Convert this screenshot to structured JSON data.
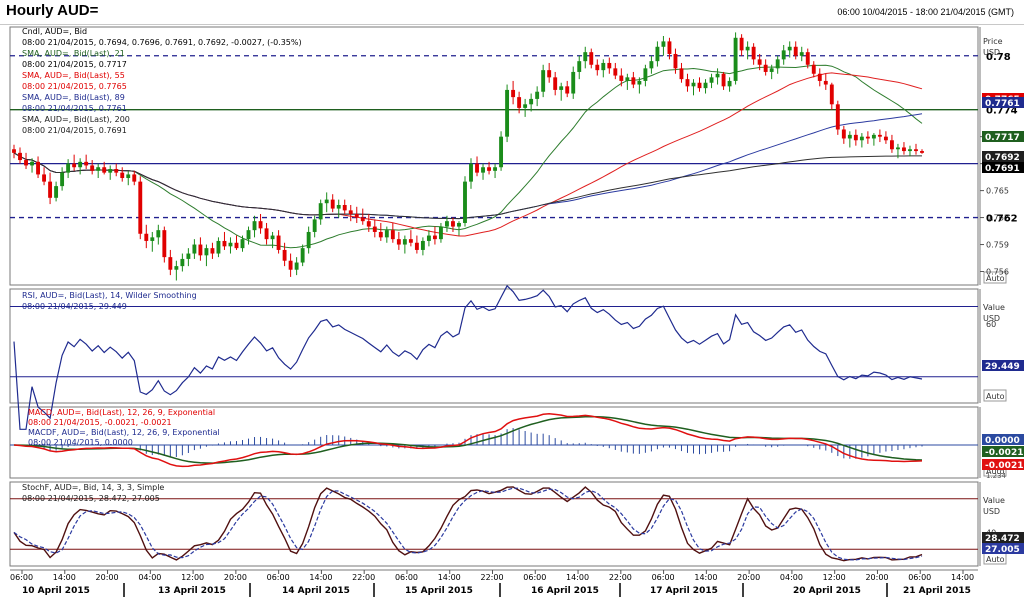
{
  "window": {
    "title": "Hourly AUD=",
    "range": "06:00 10/04/2015 - 18:00 21/04/2015 (GMT)",
    "auto_label": "Auto"
  },
  "colors": {
    "candle_up": "#1a8c1a",
    "candle_down": "#e00000",
    "sma21": "#2e7d2e",
    "sma55": "#e02020",
    "sma89": "#2b3aa0",
    "sma200": "#303030",
    "rsi": "#1f2b8f",
    "macd": "#e01010",
    "macd_signal": "#1f5f1f",
    "macd_hist": "#2b4aa0",
    "stoch_k": "#501010",
    "stoch_d": "#2b3aa0",
    "support_line": "#20208f",
    "resistance_line": "#1f5f1f",
    "dashed_line": "#20208f"
  },
  "price_panel": {
    "legend": [
      "Cndl, AUD=, Bid",
      "08:00 21/04/2015, 0.7694, 0.7696, 0.7691, 0.7692, -0.0027, (-0.35%)",
      "SMA, AUD=, Bid(Last), 21",
      "08:00 21/04/2015, 0.7717",
      "SMA, AUD=, Bid(Last), 55",
      "08:00 21/04/2015, 0.7765",
      "SMA, AUD=, Bid(Last), 89",
      "08:00 21/04/2015, 0.7761",
      "SMA, AUD=, Bid(Last), 200",
      "08:00 21/04/2015, 0.7691"
    ],
    "axis_title": [
      "Price",
      "USD"
    ],
    "ticks": [
      "0.771",
      "0.768",
      "0.765",
      "0.762",
      "0.759",
      "0.756"
    ],
    "hlines": [
      {
        "label": "0.78",
        "value": 0.78,
        "style": "dashed"
      },
      {
        "label": "0.774",
        "value": 0.774,
        "style": "solid-green"
      },
      {
        "label": "",
        "value": 0.768,
        "style": "solid-blue"
      },
      {
        "label": "0.762",
        "value": 0.762,
        "style": "dashed"
      }
    ],
    "tags": [
      {
        "label": "0.7765",
        "value": 0.7765,
        "color": "#e00000"
      },
      {
        "label": "0.7761",
        "value": 0.7761,
        "color": "#1f2b8f"
      },
      {
        "label": "0.7717",
        "value": 0.7717,
        "color": "#1f5f1f"
      },
      {
        "label": "0.7692",
        "value": 0.7692,
        "color": "#202020"
      },
      {
        "label": "0.7691",
        "value": 0.7691,
        "color": "#000000"
      }
    ]
  },
  "rsi_panel": {
    "legend": [
      "RSI, AUD=, Bid(Last), 14, Wilder Smoothing",
      "08:00 21/04/2015, 29.449"
    ],
    "axis_title": [
      "Value",
      "USD"
    ],
    "ticks": [
      "60"
    ],
    "tag": "29.449"
  },
  "macd_panel": {
    "legend": [
      "MACD, AUD=, Bid(Last), 12, 26, 9, Exponential",
      "08:00 21/04/2015, -0.0021, -0.0021",
      "MACDF, AUD=, Bid(Last), 12, 26, 9, Exponential",
      "08:00 21/04/2015, 0.0000"
    ],
    "tags": [
      "0.0000",
      "-0.0021",
      "-0.0021"
    ],
    "scale_note": "1.234"
  },
  "stoch_panel": {
    "legend": [
      "StochF, AUD=, Bid, 14, 3, 3, Simple",
      "08:00 21/04/2015, 28.472, 27.005"
    ],
    "axis_title": [
      "Value",
      "USD"
    ],
    "ticks": [
      "40"
    ],
    "tags": [
      "28.472",
      "27.005"
    ]
  },
  "time_axis": {
    "hours": [
      "06:00",
      "14:00",
      "20:00",
      "04:00",
      "12:00",
      "20:00",
      "06:00",
      "14:00",
      "22:00",
      "06:00",
      "14:00",
      "22:00",
      "06:00",
      "14:00",
      "22:00",
      "06:00",
      "14:00",
      "20:00",
      "04:00",
      "12:00",
      "20:00",
      "06:00",
      "14:00"
    ],
    "dates": [
      "10 April 2015",
      "13 April 2015",
      "14 April 2015",
      "15 April 2015",
      "16 April 2015",
      "17 April 2015",
      "20 April 2015",
      "21 April 2015"
    ]
  },
  "chart_data": {
    "type": "candlestick",
    "instrument": "AUD=",
    "interval": "Hourly",
    "ylim": [
      0.7545,
      0.7832
    ],
    "candles": [
      [
        0.7696,
        0.7701,
        0.7686,
        0.7692
      ],
      [
        0.7692,
        0.7698,
        0.768,
        0.7684
      ],
      [
        0.7684,
        0.7692,
        0.7674,
        0.7678
      ],
      [
        0.7678,
        0.7686,
        0.767,
        0.7682
      ],
      [
        0.7682,
        0.7688,
        0.7664,
        0.7668
      ],
      [
        0.7668,
        0.7676,
        0.7656,
        0.766
      ],
      [
        0.766,
        0.767,
        0.7635,
        0.7642
      ],
      [
        0.7642,
        0.766,
        0.7638,
        0.7655
      ],
      [
        0.7655,
        0.7676,
        0.765,
        0.767
      ],
      [
        0.767,
        0.7685,
        0.7664,
        0.768
      ],
      [
        0.768,
        0.769,
        0.7672,
        0.7676
      ],
      [
        0.7676,
        0.7686,
        0.7668,
        0.7682
      ],
      [
        0.7682,
        0.769,
        0.7674,
        0.7678
      ],
      [
        0.7678,
        0.7684,
        0.7668,
        0.7672
      ],
      [
        0.7672,
        0.768,
        0.7664,
        0.7676
      ],
      [
        0.7676,
        0.7682,
        0.7668,
        0.767
      ],
      [
        0.767,
        0.7678,
        0.7662,
        0.7674
      ],
      [
        0.7674,
        0.768,
        0.7666,
        0.767
      ],
      [
        0.767,
        0.7676,
        0.766,
        0.7664
      ],
      [
        0.7664,
        0.7672,
        0.7656,
        0.7668
      ],
      [
        0.7668,
        0.7672,
        0.7656,
        0.766
      ],
      [
        0.766,
        0.7666,
        0.7596,
        0.7602
      ],
      [
        0.7602,
        0.7612,
        0.7586,
        0.7594
      ],
      [
        0.7594,
        0.7604,
        0.7582,
        0.7598
      ],
      [
        0.7598,
        0.7612,
        0.759,
        0.7606
      ],
      [
        0.7606,
        0.761,
        0.757,
        0.7576
      ],
      [
        0.7576,
        0.7584,
        0.7556,
        0.7562
      ],
      [
        0.7562,
        0.7572,
        0.755,
        0.7566
      ],
      [
        0.7566,
        0.758,
        0.756,
        0.7574
      ],
      [
        0.7574,
        0.7586,
        0.7566,
        0.758
      ],
      [
        0.758,
        0.7596,
        0.7574,
        0.759
      ],
      [
        0.759,
        0.7598,
        0.7572,
        0.7578
      ],
      [
        0.7578,
        0.759,
        0.7566,
        0.7586
      ],
      [
        0.7586,
        0.7592,
        0.7574,
        0.758
      ],
      [
        0.758,
        0.7598,
        0.7576,
        0.7594
      ],
      [
        0.7594,
        0.7604,
        0.7584,
        0.7588
      ],
      [
        0.7588,
        0.7598,
        0.758,
        0.7592
      ],
      [
        0.7592,
        0.76,
        0.7584,
        0.7586
      ],
      [
        0.7586,
        0.76,
        0.7582,
        0.7596
      ],
      [
        0.7596,
        0.761,
        0.759,
        0.7606
      ],
      [
        0.7606,
        0.7622,
        0.7598,
        0.7616
      ],
      [
        0.7616,
        0.7624,
        0.7602,
        0.7608
      ],
      [
        0.7608,
        0.7614,
        0.759,
        0.7596
      ],
      [
        0.7596,
        0.7604,
        0.7586,
        0.76
      ],
      [
        0.76,
        0.7606,
        0.758,
        0.7584
      ],
      [
        0.7584,
        0.7592,
        0.7566,
        0.7572
      ],
      [
        0.7572,
        0.758,
        0.7554,
        0.7562
      ],
      [
        0.7562,
        0.7576,
        0.7556,
        0.757
      ],
      [
        0.757,
        0.759,
        0.7566,
        0.7586
      ],
      [
        0.7586,
        0.761,
        0.758,
        0.7604
      ],
      [
        0.7604,
        0.7622,
        0.7598,
        0.7618
      ],
      [
        0.7618,
        0.764,
        0.7612,
        0.7636
      ],
      [
        0.7636,
        0.7648,
        0.7626,
        0.764
      ],
      [
        0.764,
        0.7646,
        0.7626,
        0.763
      ],
      [
        0.763,
        0.764,
        0.762,
        0.7634
      ],
      [
        0.7634,
        0.764,
        0.7624,
        0.7628
      ],
      [
        0.7628,
        0.7634,
        0.7616,
        0.7624
      ],
      [
        0.7624,
        0.7632,
        0.7614,
        0.762
      ],
      [
        0.762,
        0.763,
        0.7612,
        0.7616
      ],
      [
        0.7616,
        0.7624,
        0.7604,
        0.761
      ],
      [
        0.761,
        0.7618,
        0.7598,
        0.7604
      ],
      [
        0.7604,
        0.7614,
        0.7594,
        0.7598
      ],
      [
        0.7598,
        0.761,
        0.7592,
        0.7606
      ],
      [
        0.7606,
        0.7614,
        0.7592,
        0.7596
      ],
      [
        0.7596,
        0.7604,
        0.7584,
        0.759
      ],
      [
        0.759,
        0.76,
        0.758,
        0.7596
      ],
      [
        0.7596,
        0.7606,
        0.7588,
        0.7592
      ],
      [
        0.7592,
        0.76,
        0.758,
        0.7584
      ],
      [
        0.7584,
        0.7598,
        0.7578,
        0.7594
      ],
      [
        0.7594,
        0.7606,
        0.7588,
        0.76
      ],
      [
        0.76,
        0.761,
        0.759,
        0.7596
      ],
      [
        0.7596,
        0.7614,
        0.7592,
        0.761
      ],
      [
        0.761,
        0.7622,
        0.7604,
        0.7616
      ],
      [
        0.7616,
        0.762,
        0.7604,
        0.761
      ],
      [
        0.761,
        0.7616,
        0.76,
        0.7614
      ],
      [
        0.7614,
        0.7666,
        0.761,
        0.766
      ],
      [
        0.766,
        0.7686,
        0.7652,
        0.768
      ],
      [
        0.768,
        0.7688,
        0.7666,
        0.767
      ],
      [
        0.767,
        0.768,
        0.7662,
        0.7676
      ],
      [
        0.7676,
        0.7682,
        0.7668,
        0.7672
      ],
      [
        0.7672,
        0.768,
        0.7664,
        0.7676
      ],
      [
        0.7676,
        0.7716,
        0.7672,
        0.771
      ],
      [
        0.771,
        0.7768,
        0.7704,
        0.7762
      ],
      [
        0.7762,
        0.7772,
        0.7746,
        0.7754
      ],
      [
        0.7754,
        0.776,
        0.7736,
        0.7742
      ],
      [
        0.7742,
        0.7752,
        0.7732,
        0.7746
      ],
      [
        0.7746,
        0.7758,
        0.7738,
        0.7752
      ],
      [
        0.7752,
        0.7766,
        0.7744,
        0.776
      ],
      [
        0.776,
        0.779,
        0.7754,
        0.7784
      ],
      [
        0.7784,
        0.7792,
        0.777,
        0.7776
      ],
      [
        0.7776,
        0.7782,
        0.7756,
        0.7762
      ],
      [
        0.7762,
        0.777,
        0.775,
        0.7766
      ],
      [
        0.7766,
        0.7772,
        0.7754,
        0.7758
      ],
      [
        0.7758,
        0.7788,
        0.7752,
        0.7782
      ],
      [
        0.7782,
        0.78,
        0.7774,
        0.7794
      ],
      [
        0.7794,
        0.781,
        0.7786,
        0.7804
      ],
      [
        0.7804,
        0.7808,
        0.7786,
        0.779
      ],
      [
        0.779,
        0.7796,
        0.7778,
        0.7784
      ],
      [
        0.7784,
        0.7796,
        0.7776,
        0.7792
      ],
      [
        0.7792,
        0.7798,
        0.778,
        0.7786
      ],
      [
        0.7786,
        0.7792,
        0.7774,
        0.7778
      ],
      [
        0.7778,
        0.7786,
        0.7766,
        0.7772
      ],
      [
        0.7772,
        0.778,
        0.7762,
        0.7776
      ],
      [
        0.7776,
        0.7782,
        0.7764,
        0.7768
      ],
      [
        0.7768,
        0.7776,
        0.7758,
        0.7772
      ],
      [
        0.7772,
        0.779,
        0.7766,
        0.7786
      ],
      [
        0.7786,
        0.78,
        0.778,
        0.7794
      ],
      [
        0.7794,
        0.7816,
        0.7788,
        0.781
      ],
      [
        0.781,
        0.7822,
        0.78,
        0.7816
      ],
      [
        0.7816,
        0.782,
        0.7796,
        0.7802
      ],
      [
        0.7802,
        0.7808,
        0.778,
        0.7786
      ],
      [
        0.7786,
        0.7792,
        0.777,
        0.7774
      ],
      [
        0.7774,
        0.778,
        0.776,
        0.7766
      ],
      [
        0.7766,
        0.7774,
        0.7756,
        0.777
      ],
      [
        0.777,
        0.7776,
        0.776,
        0.7764
      ],
      [
        0.7764,
        0.7774,
        0.7758,
        0.777
      ],
      [
        0.777,
        0.778,
        0.7764,
        0.7776
      ],
      [
        0.7776,
        0.7786,
        0.7768,
        0.778
      ],
      [
        0.778,
        0.7782,
        0.7762,
        0.7766
      ],
      [
        0.7766,
        0.7776,
        0.776,
        0.7772
      ],
      [
        0.7772,
        0.7826,
        0.7768,
        0.782
      ],
      [
        0.782,
        0.7824,
        0.78,
        0.7806
      ],
      [
        0.7806,
        0.7816,
        0.7796,
        0.781
      ],
      [
        0.781,
        0.7814,
        0.779,
        0.7796
      ],
      [
        0.7796,
        0.7802,
        0.7784,
        0.779
      ],
      [
        0.779,
        0.7796,
        0.7778,
        0.7782
      ],
      [
        0.7782,
        0.779,
        0.7774,
        0.7786
      ],
      [
        0.7786,
        0.78,
        0.778,
        0.7796
      ],
      [
        0.7796,
        0.7812,
        0.779,
        0.7806
      ],
      [
        0.7806,
        0.7816,
        0.7798,
        0.781
      ],
      [
        0.781,
        0.7816,
        0.7796,
        0.78
      ],
      [
        0.78,
        0.781,
        0.7794,
        0.7804
      ],
      [
        0.7804,
        0.7808,
        0.7786,
        0.779
      ],
      [
        0.779,
        0.7794,
        0.7776,
        0.778
      ],
      [
        0.778,
        0.7786,
        0.7766,
        0.7772
      ],
      [
        0.7772,
        0.778,
        0.7762,
        0.7768
      ],
      [
        0.7768,
        0.777,
        0.774,
        0.7746
      ],
      [
        0.7746,
        0.775,
        0.7712,
        0.7718
      ],
      [
        0.7718,
        0.7722,
        0.7702,
        0.7708
      ],
      [
        0.7708,
        0.7716,
        0.7698,
        0.7712
      ],
      [
        0.7712,
        0.7718,
        0.77,
        0.7706
      ],
      [
        0.7706,
        0.7714,
        0.7698,
        0.771
      ],
      [
        0.771,
        0.7716,
        0.7702,
        0.7708
      ],
      [
        0.7708,
        0.7714,
        0.77,
        0.7712
      ],
      [
        0.7712,
        0.7718,
        0.7704,
        0.771
      ],
      [
        0.771,
        0.7716,
        0.7702,
        0.7706
      ],
      [
        0.7706,
        0.7712,
        0.7692,
        0.7696
      ],
      [
        0.7696,
        0.7702,
        0.7686,
        0.7698
      ],
      [
        0.7698,
        0.7704,
        0.769,
        0.7694
      ],
      [
        0.7694,
        0.77,
        0.7688,
        0.7696
      ],
      [
        0.7696,
        0.7702,
        0.769,
        0.7694
      ],
      [
        0.7694,
        0.7696,
        0.7691,
        0.7692
      ]
    ],
    "series_last": {
      "SMA 21": 0.7717,
      "SMA 55": 0.7765,
      "SMA 89": 0.7761,
      "SMA 200": 0.7691
    },
    "indicators_last": {
      "RSI 14": 29.449,
      "MACD": -0.0021,
      "MACD signal": -0.0021,
      "MACDF": 0.0,
      "StochF %K": 28.472,
      "StochF %D": 27.005
    }
  }
}
